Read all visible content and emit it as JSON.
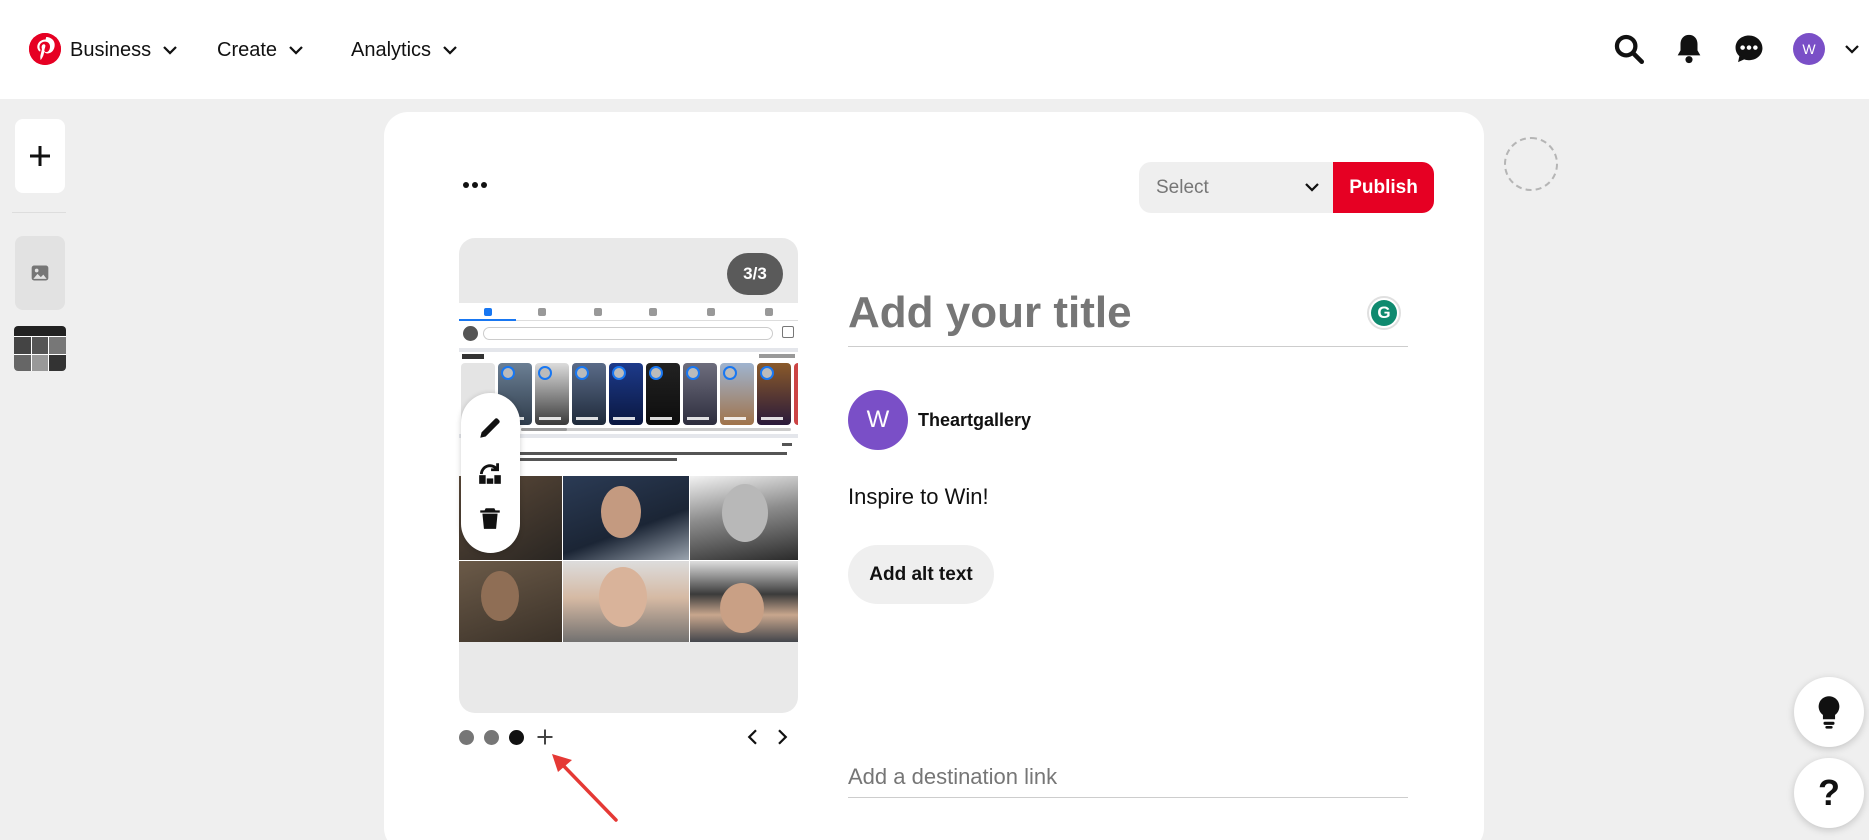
{
  "nav": {
    "business": "Business",
    "create": "Create",
    "analytics": "Analytics",
    "avatar_initial": "W"
  },
  "toolbar": {
    "select_label": "Select",
    "publish_label": "Publish"
  },
  "preview": {
    "counter": "3/3",
    "current_slide": 3,
    "total_slides": 3
  },
  "form": {
    "title_placeholder": "Add your title",
    "grammarly_letter": "G",
    "profile_initial": "W",
    "username": "Theartgallery",
    "description": "Inspire to Win!",
    "alt_text_button": "Add alt text",
    "link_placeholder": "Add a destination link"
  },
  "help": {
    "question": "?"
  },
  "colors": {
    "brand": "#e60023",
    "avatar": "#7a4fc7"
  }
}
